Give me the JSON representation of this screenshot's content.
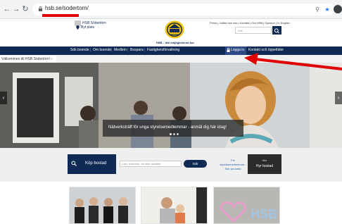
{
  "browser": {
    "back_icon": "arrow-left-icon",
    "forward_icon": "arrow-right-icon",
    "reload_icon": "reload-icon",
    "url": "hsb.se/sodertorn/"
  },
  "header": {
    "region_name": "HSB Södertörn",
    "region_place": "Byt plats",
    "tagline": "HSB – där möjligheterna bor",
    "top_links": "Press | Jobba hos oss | Kontakt | Om HSB | Synskor | In English",
    "search_placeholder": "Sök"
  },
  "nav": {
    "items": [
      "Sök boende",
      "Om boende",
      "Medlem",
      "Bospara",
      "Fastighetsförvaltning"
    ],
    "login": "Logga in",
    "extra": "Kontakt och öppettider"
  },
  "breadcrumb": "Välkommen till HSB Södertörn!",
  "hero": {
    "caption": "Nätverksträff för unga styrelsemedlemmar - anmäl dig här idag!"
  },
  "search": {
    "kop_label": "Köp bostad",
    "input_placeholder": "Län, kommun, ort eller område",
    "button_label": "Sök",
    "styrelse_text": "För styrelsemedlemmar - Sök via karta",
    "hyr_small": "eller",
    "hyr_label": "Hyr bostad"
  },
  "colors": {
    "brand_navy": "#0f2a55",
    "annotation_red": "#e00000"
  }
}
